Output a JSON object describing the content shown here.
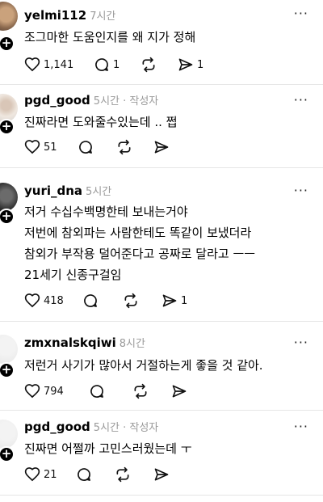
{
  "posts": [
    {
      "user": "yelmi112",
      "meta": "7시간",
      "lines": [
        "조그마한 도움인지를 왜 지가 정해"
      ],
      "likes": "1,141",
      "comments": "1",
      "reposts": "",
      "shares": "1"
    },
    {
      "user": "pgd_good",
      "meta": "5시간 · 작성자",
      "lines": [
        "진짜라면 도와줄수있는데 .. 쩝"
      ],
      "likes": "51",
      "comments": "",
      "reposts": "",
      "shares": ""
    },
    {
      "user": "yuri_dna",
      "meta": "5시간",
      "lines": [
        "저거 수십수백명한테 보내는거야",
        "저번에 참외파는 사람한테도 똑같이 보냈더라",
        "참외가 부작용 덜어준다고 공짜로 달라고 ㅡㅡ",
        "21세기 신종구걸임"
      ],
      "likes": "418",
      "comments": "",
      "reposts": "",
      "shares": "1"
    },
    {
      "user": "zmxnalskqiwi",
      "meta": "8시간",
      "lines": [
        "저런거 사기가 많아서 거절하는게 좋을 것 같아."
      ],
      "likes": "794",
      "comments": "",
      "reposts": "",
      "shares": ""
    },
    {
      "user": "pgd_good",
      "meta": "5시간 · 작성자",
      "lines": [
        "진짜면 어쩔까 고민스러웠는데 ㅜ"
      ],
      "likes": "21",
      "comments": "",
      "reposts": "",
      "shares": ""
    }
  ],
  "more_glyph": "···",
  "plus_glyph": "+",
  "icons": [
    "heart-icon",
    "comment-icon",
    "repost-icon",
    "share-icon",
    "more-icon",
    "follow-plus-icon"
  ]
}
